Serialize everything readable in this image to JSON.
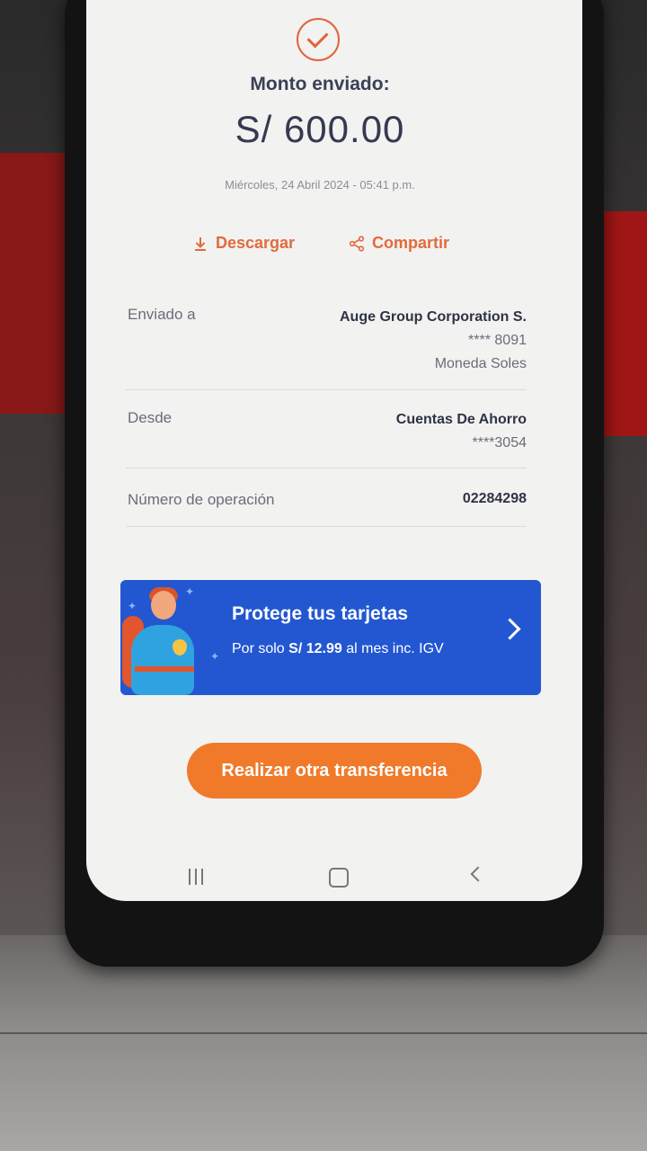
{
  "receipt": {
    "title": "Monto enviado:",
    "amount": "S/ 600.00",
    "date": "Miércoles, 24 Abril 2024 - 05:41 p.m."
  },
  "actions": {
    "download_label": "Descargar",
    "share_label": "Compartir"
  },
  "details": {
    "sent_to": {
      "label": "Enviado a",
      "name": "Auge Group Corporation S.",
      "account": "**** 8091",
      "currency": "Moneda Soles"
    },
    "from": {
      "label": "Desde",
      "account_type": "Cuentas De Ahorro",
      "account": "****3054"
    },
    "operation": {
      "label": "Número de operación",
      "number": "02284298"
    }
  },
  "banner": {
    "title": "Protege tus tarjetas",
    "sub_prefix": "Por solo",
    "sub_price": "S/ 12.99",
    "sub_suffix": "al mes inc. IGV"
  },
  "cta": {
    "label": "Realizar otra transferencia"
  },
  "colors": {
    "accent": "#e26a3c",
    "cta": "#f07a2a",
    "banner": "#2357d2"
  },
  "icons": [
    "check-circle-icon",
    "download-icon",
    "share-icon",
    "superhero-illustration",
    "chevron-right-icon",
    "recents-icon",
    "home-icon",
    "back-icon"
  ]
}
